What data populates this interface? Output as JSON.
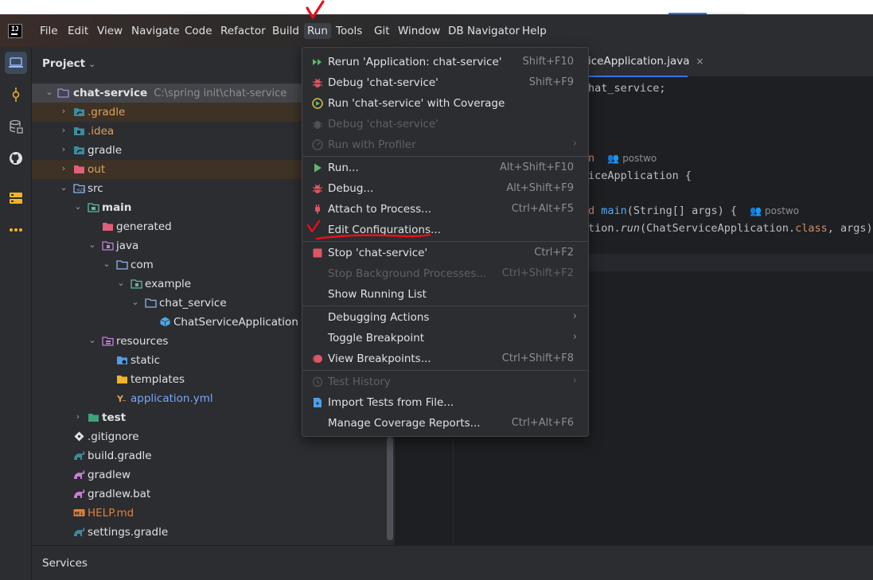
{
  "menubar": {
    "items": [
      {
        "label": "File"
      },
      {
        "label": "Edit"
      },
      {
        "label": "View"
      },
      {
        "label": "Navigate"
      },
      {
        "label": "Code"
      },
      {
        "label": "Refactor"
      },
      {
        "label": "Build"
      },
      {
        "label": "Run"
      },
      {
        "label": "Tools"
      },
      {
        "label": "Git"
      },
      {
        "label": "Window"
      },
      {
        "label": "DB Navigator"
      },
      {
        "label": "Help"
      }
    ],
    "logo_text": "IJ"
  },
  "toolstrip": {
    "icons": [
      "project-icon",
      "commit-icon",
      "database-icon",
      "github-icon",
      "services-icon",
      "more-icon"
    ]
  },
  "project": {
    "title": "Project",
    "tree": [
      {
        "label": "chat-service",
        "path": "C:\\spring init\\chat-service"
      },
      {
        "label": ".gradle"
      },
      {
        "label": ".idea"
      },
      {
        "label": "gradle"
      },
      {
        "label": "out"
      },
      {
        "label": "src"
      },
      {
        "label": "main"
      },
      {
        "label": "generated"
      },
      {
        "label": "java"
      },
      {
        "label": "com"
      },
      {
        "label": "example"
      },
      {
        "label": "chat_service"
      },
      {
        "label": "ChatServiceApplication"
      },
      {
        "label": "resources"
      },
      {
        "label": "static"
      },
      {
        "label": "templates"
      },
      {
        "label": "application.yml"
      },
      {
        "label": "test"
      },
      {
        "label": ".gitignore"
      },
      {
        "label": "build.gradle"
      },
      {
        "label": "gradlew"
      },
      {
        "label": "gradlew.bat"
      },
      {
        "label": "HELP.md"
      },
      {
        "label": "settings.gradle"
      }
    ]
  },
  "editor": {
    "tab_label": "iceApplication.java",
    "tab_close": "×",
    "code": {
      "line1": "hat_service;",
      "line2_kw": "n",
      "line2_hint": "postwo",
      "line3": "iceApplication {",
      "line4_kw": "d",
      "line4_fn": "main",
      "line4_rest": "(String[] args) {",
      "line4_hint": "postwo",
      "line5_a": "tion.",
      "line5_fn": "run",
      "line5_b": "(ChatServiceApplication.",
      "line5_kw": "class",
      "line5_c": ", args);"
    }
  },
  "run_menu": {
    "items": [
      {
        "label": "Rerun 'Application: chat-service'",
        "shortcut": "Shift+F10"
      },
      {
        "label": "Debug 'chat-service'",
        "shortcut": "Shift+F9"
      },
      {
        "label": "Run 'chat-service' with Coverage",
        "shortcut": ""
      },
      {
        "label": "Debug 'chat-service'",
        "shortcut": ""
      },
      {
        "label": "Run with Profiler",
        "shortcut": "",
        "submenu": "›"
      },
      {
        "label": "Run...",
        "shortcut": "Alt+Shift+F10"
      },
      {
        "label": "Debug...",
        "shortcut": "Alt+Shift+F9"
      },
      {
        "label": "Attach to Process...",
        "shortcut": "Ctrl+Alt+F5"
      },
      {
        "label": "Edit Configurations...",
        "shortcut": ""
      },
      {
        "label": "Stop 'chat-service'",
        "shortcut": "Ctrl+F2"
      },
      {
        "label": "Stop Background Processes...",
        "shortcut": "Ctrl+Shift+F2"
      },
      {
        "label": "Show Running List",
        "shortcut": ""
      },
      {
        "label": "Debugging Actions",
        "shortcut": "",
        "submenu": "›"
      },
      {
        "label": "Toggle Breakpoint",
        "shortcut": "",
        "submenu": "›"
      },
      {
        "label": "View Breakpoints...",
        "shortcut": "Ctrl+Shift+F8"
      },
      {
        "label": "Test History",
        "shortcut": "",
        "submenu": "›"
      },
      {
        "label": "Import Tests from File...",
        "shortcut": ""
      },
      {
        "label": "Manage Coverage Reports...",
        "shortcut": "Ctrl+Alt+F6"
      }
    ]
  },
  "services": {
    "label": "Services"
  },
  "colors": {
    "accent": "#3574f0",
    "annotation_red": "#e8101a",
    "menu_bg": "#2b2d30",
    "editor_bg": "#1e1f22"
  }
}
